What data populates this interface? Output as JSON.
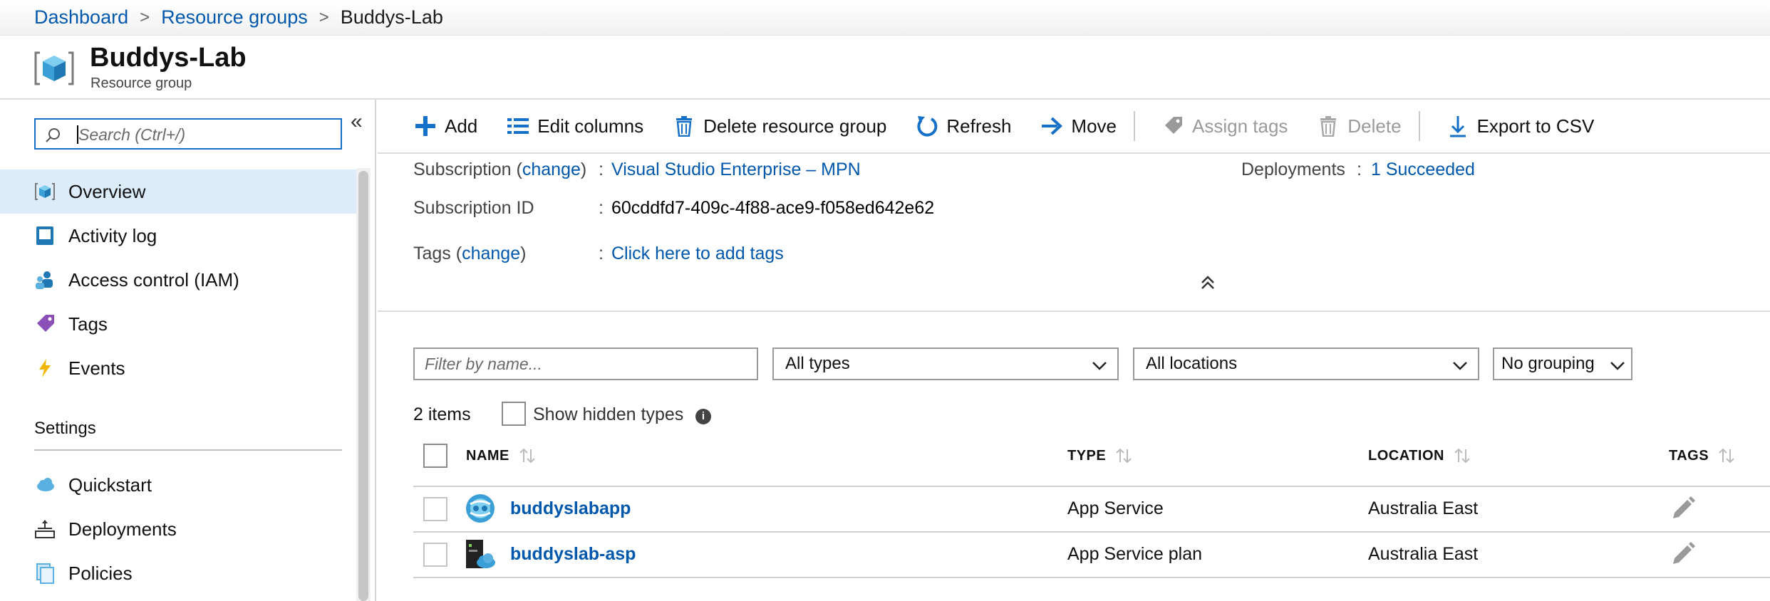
{
  "breadcrumb": {
    "items": [
      "Dashboard",
      "Resource groups",
      "Buddys-Lab"
    ],
    "separator": ">"
  },
  "header": {
    "title": "Buddys-Lab",
    "subtitle": "Resource group"
  },
  "sidebar": {
    "search_placeholder": "Search (Ctrl+/)",
    "collapse_glyph": "«",
    "items": [
      {
        "label": "Overview",
        "icon": "resource-group-icon",
        "active": true
      },
      {
        "label": "Activity log",
        "icon": "activity-log-icon"
      },
      {
        "label": "Access control (IAM)",
        "icon": "iam-icon"
      },
      {
        "label": "Tags",
        "icon": "tag-icon"
      },
      {
        "label": "Events",
        "icon": "lightning-icon"
      }
    ],
    "section": "Settings",
    "settings_items": [
      {
        "label": "Quickstart",
        "icon": "cloud-icon"
      },
      {
        "label": "Deployments",
        "icon": "deployments-icon"
      },
      {
        "label": "Policies",
        "icon": "policies-icon"
      }
    ]
  },
  "toolbar": {
    "add": "Add",
    "edit_columns": "Edit columns",
    "delete_group": "Delete resource group",
    "refresh": "Refresh",
    "move": "Move",
    "assign_tags": "Assign tags",
    "delete": "Delete",
    "export_csv": "Export to CSV"
  },
  "essentials": {
    "subscription_label_pre": "Subscription (",
    "change": "change",
    "subscription_label_post": ")",
    "colon": ":",
    "subscription_value": "Visual Studio Enterprise – MPN",
    "subscription_id_label": "Subscription ID",
    "subscription_id_value": "60cddfd7-409c-4f88-ace9-f058ed642e62",
    "tags_label_pre": "Tags (",
    "tags_label_post": ")",
    "tags_value": "Click here to add tags",
    "deployments_label": "Deployments",
    "deployments_value": "1 Succeeded"
  },
  "filters": {
    "name_placeholder": "Filter by name...",
    "types": "All types",
    "locations": "All locations",
    "grouping": "No grouping"
  },
  "list": {
    "count": "2 items",
    "show_hidden": "Show hidden types",
    "columns": [
      "NAME",
      "TYPE",
      "LOCATION",
      "TAGS"
    ],
    "rows": [
      {
        "name": "buddyslabapp",
        "type": "App Service",
        "location": "Australia East",
        "icon": "app-service-icon"
      },
      {
        "name": "buddyslab-asp",
        "type": "App Service plan",
        "location": "Australia East",
        "icon": "app-service-plan-icon"
      }
    ]
  },
  "colors": {
    "link": "#0058ad",
    "active_bg": "#dcecfa",
    "accent": "#1570c7"
  }
}
